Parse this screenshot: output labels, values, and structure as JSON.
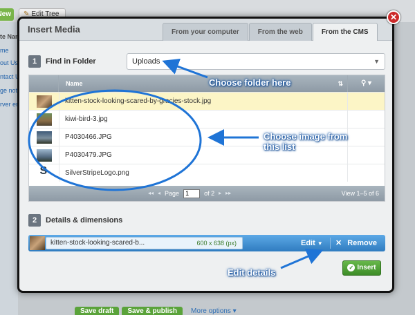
{
  "background": {
    "new_button": "New",
    "edit_tree_button": "Edit Tree",
    "sidebar": [
      "te Nan",
      "me",
      "out Us",
      "ntact U",
      "ge not",
      "rver er"
    ],
    "buttons": [
      "Save draft",
      "Save & publish"
    ],
    "more_options": "More options ▾"
  },
  "dialog": {
    "title": "Insert Media",
    "tabs": [
      {
        "label": "From your computer",
        "active": false
      },
      {
        "label": "From the web",
        "active": false
      },
      {
        "label": "From the CMS",
        "active": true
      }
    ],
    "close_glyph": "✕",
    "step1": {
      "number": "1",
      "label": "Find in Folder"
    },
    "folder_select": {
      "value": "Uploads"
    },
    "table": {
      "header_name": "Name",
      "files": [
        {
          "name": "kitten-stock-looking-scared-by-gracies-stock.jpg",
          "thumb": "kitten",
          "selected": true
        },
        {
          "name": "kiwi-bird-3.jpg",
          "thumb": "kiwi",
          "selected": false
        },
        {
          "name": "P4030466.JPG",
          "thumb": "p466",
          "selected": false
        },
        {
          "name": "P4030479.JPG",
          "thumb": "p479",
          "selected": false
        },
        {
          "name": "SilverStripeLogo.png",
          "thumb": "logo",
          "selected": false
        }
      ],
      "pager": {
        "page_label": "Page",
        "page_value": "1",
        "of_label": "of 2"
      },
      "view_count": "View 1–5 of 6"
    },
    "step2": {
      "number": "2",
      "label": "Details & dimensions"
    },
    "selected_item": {
      "filename": "kitten-stock-looking-scared-b...",
      "dimensions": "600 x 638 (px)",
      "edit_label": "Edit",
      "remove_label": "Remove"
    },
    "insert_label": "Insert"
  },
  "annotations": {
    "folder": "Choose folder here",
    "image": [
      "Choose image from",
      "this list"
    ],
    "edit": "Edit details",
    "color": "#1f74d6"
  }
}
